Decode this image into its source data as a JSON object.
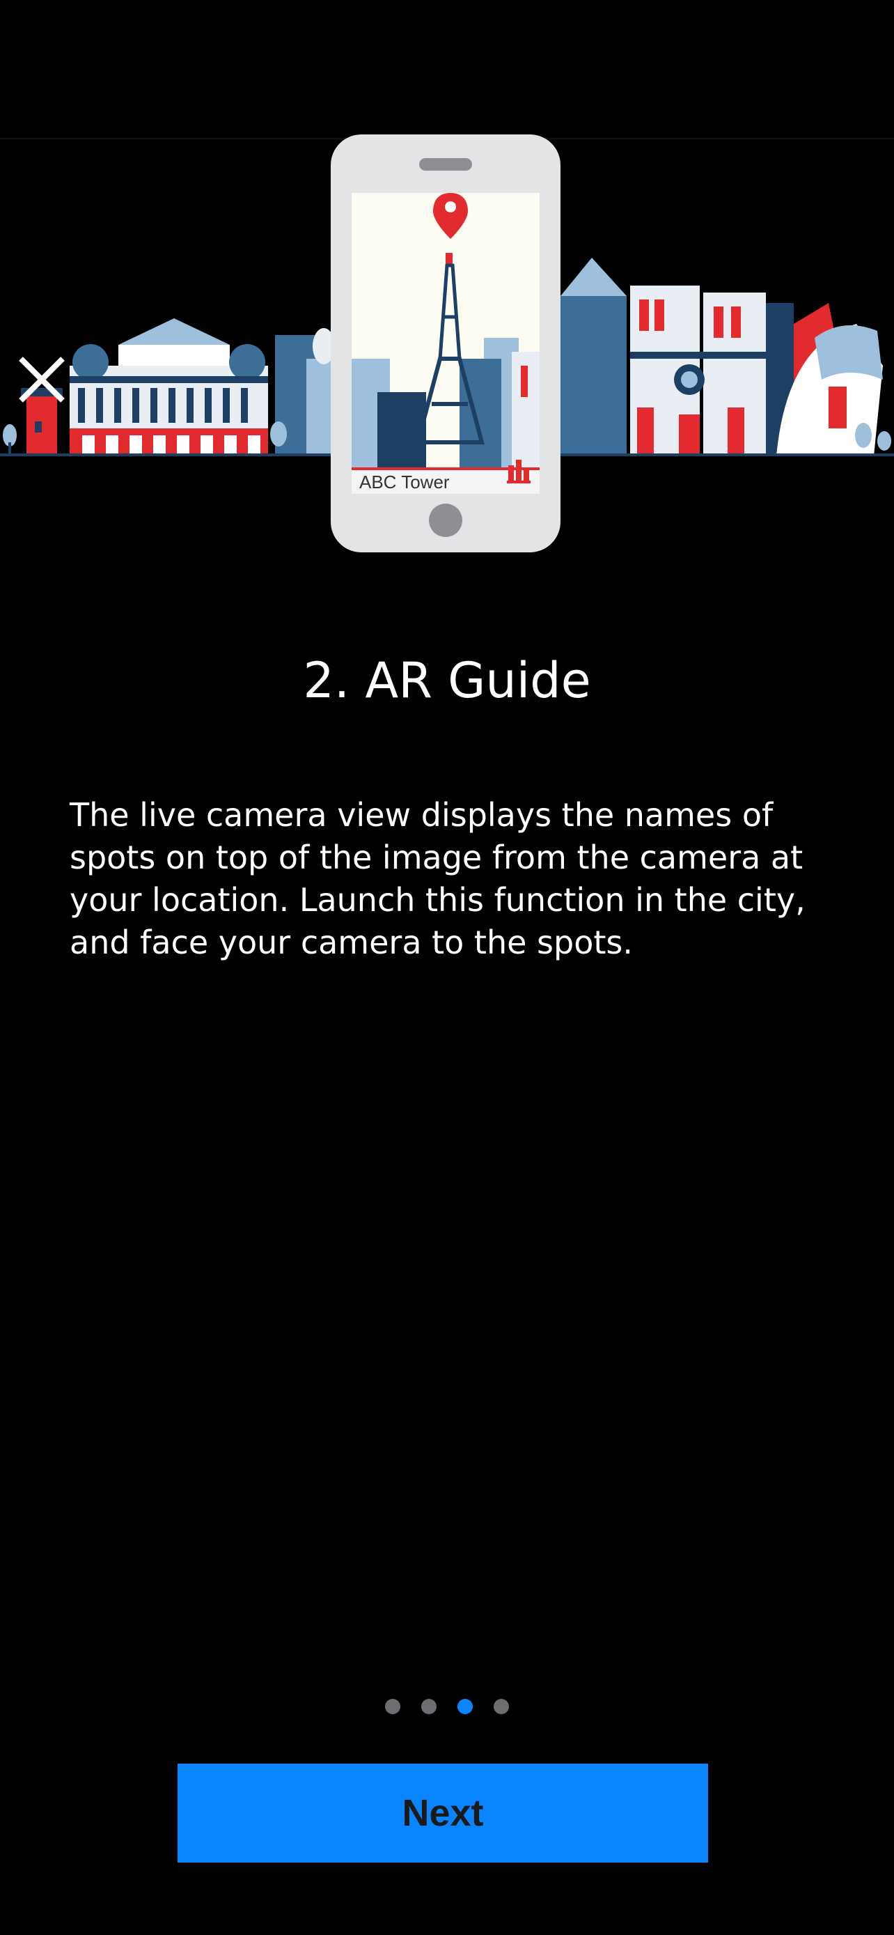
{
  "hero": {
    "phone_screen_label": "ABC Tower",
    "colors": {
      "navy": "#1c3f63",
      "blue": "#3c6e97",
      "lightblue": "#9fc0dc",
      "red": "#e32b2f",
      "phone": "#e3e4e6"
    }
  },
  "onboarding": {
    "title": "2. AR Guide",
    "description": "The live camera view displays the names of\nspots on top of the image from the camera at\nyour location. Launch this function in the city,\nand face your camera to the spots.",
    "page_count": 4,
    "current_page": 3
  },
  "actions": {
    "next_label": "Next"
  },
  "accent_color": "#0a84ff"
}
